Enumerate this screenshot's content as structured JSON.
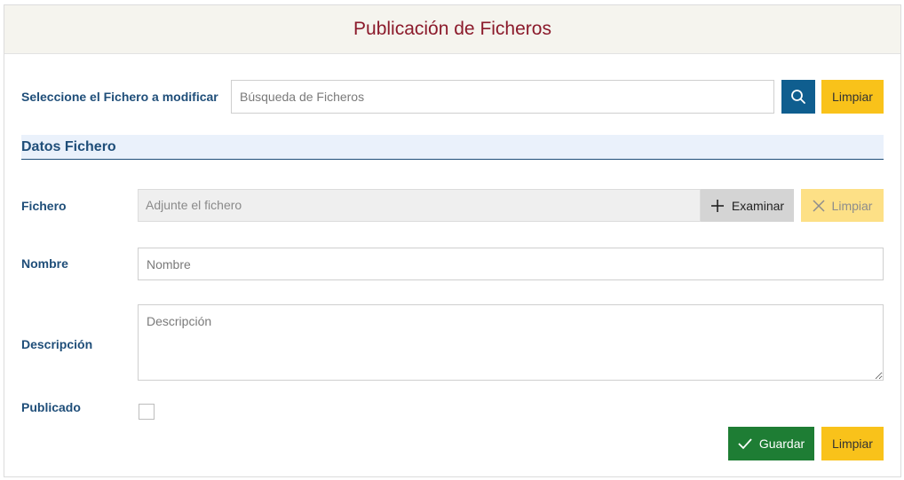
{
  "header": {
    "title": "Publicación de Ficheros"
  },
  "search": {
    "label": "Seleccione el Fichero a modificar",
    "placeholder": "Búsqueda de Ficheros",
    "clear_label": "Limpiar"
  },
  "section": {
    "title": "Datos Fichero"
  },
  "fichero": {
    "label": "Fichero",
    "placeholder": "Adjunte el fichero",
    "browse_label": "Examinar",
    "clear_label": "Limpiar"
  },
  "nombre": {
    "label": "Nombre",
    "placeholder": "Nombre",
    "value": ""
  },
  "descripcion": {
    "label": "Descripción",
    "placeholder": "Descripción",
    "value": ""
  },
  "publicado": {
    "label": "Publicado",
    "checked": false
  },
  "actions": {
    "save_label": "Guardar",
    "clear_label": "Limpiar"
  },
  "colors": {
    "title": "#8b1a2b",
    "label": "#1f4e79",
    "primary": "#0f5e8f",
    "warning": "#f9c21a",
    "success": "#1e7d34"
  }
}
